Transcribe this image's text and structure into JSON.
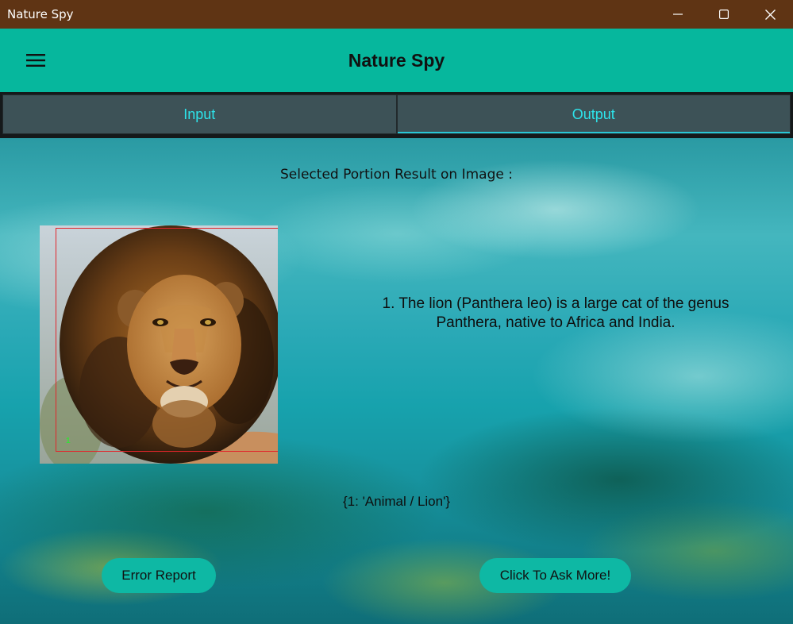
{
  "window": {
    "title": "Nature Spy",
    "controls": [
      "minimize-icon",
      "maximize-icon",
      "close-icon"
    ]
  },
  "appbar": {
    "menu_icon": "hamburger-menu-icon",
    "title": "Nature Spy",
    "color": "#06b79d"
  },
  "tabs": [
    {
      "label": "Input",
      "active": false
    },
    {
      "label": "Output",
      "active": true
    }
  ],
  "output": {
    "heading": "Selected Portion Result on Image :",
    "image_alt": "lion",
    "detection": {
      "label": "1",
      "box_color": "#e2252b"
    },
    "description": "1. The lion (Panthera leo) is a large cat of the genus Panthera, native to Africa and India.",
    "classes": "{1: 'Animal / Lion'}"
  },
  "buttons": {
    "error_report": "Error Report",
    "ask_more": "Click To Ask More!"
  },
  "colors": {
    "titlebar": "#5f3414",
    "tab_text": "#2de3ea",
    "tab_background": "#3d5257",
    "button": "#0eb8a4"
  }
}
